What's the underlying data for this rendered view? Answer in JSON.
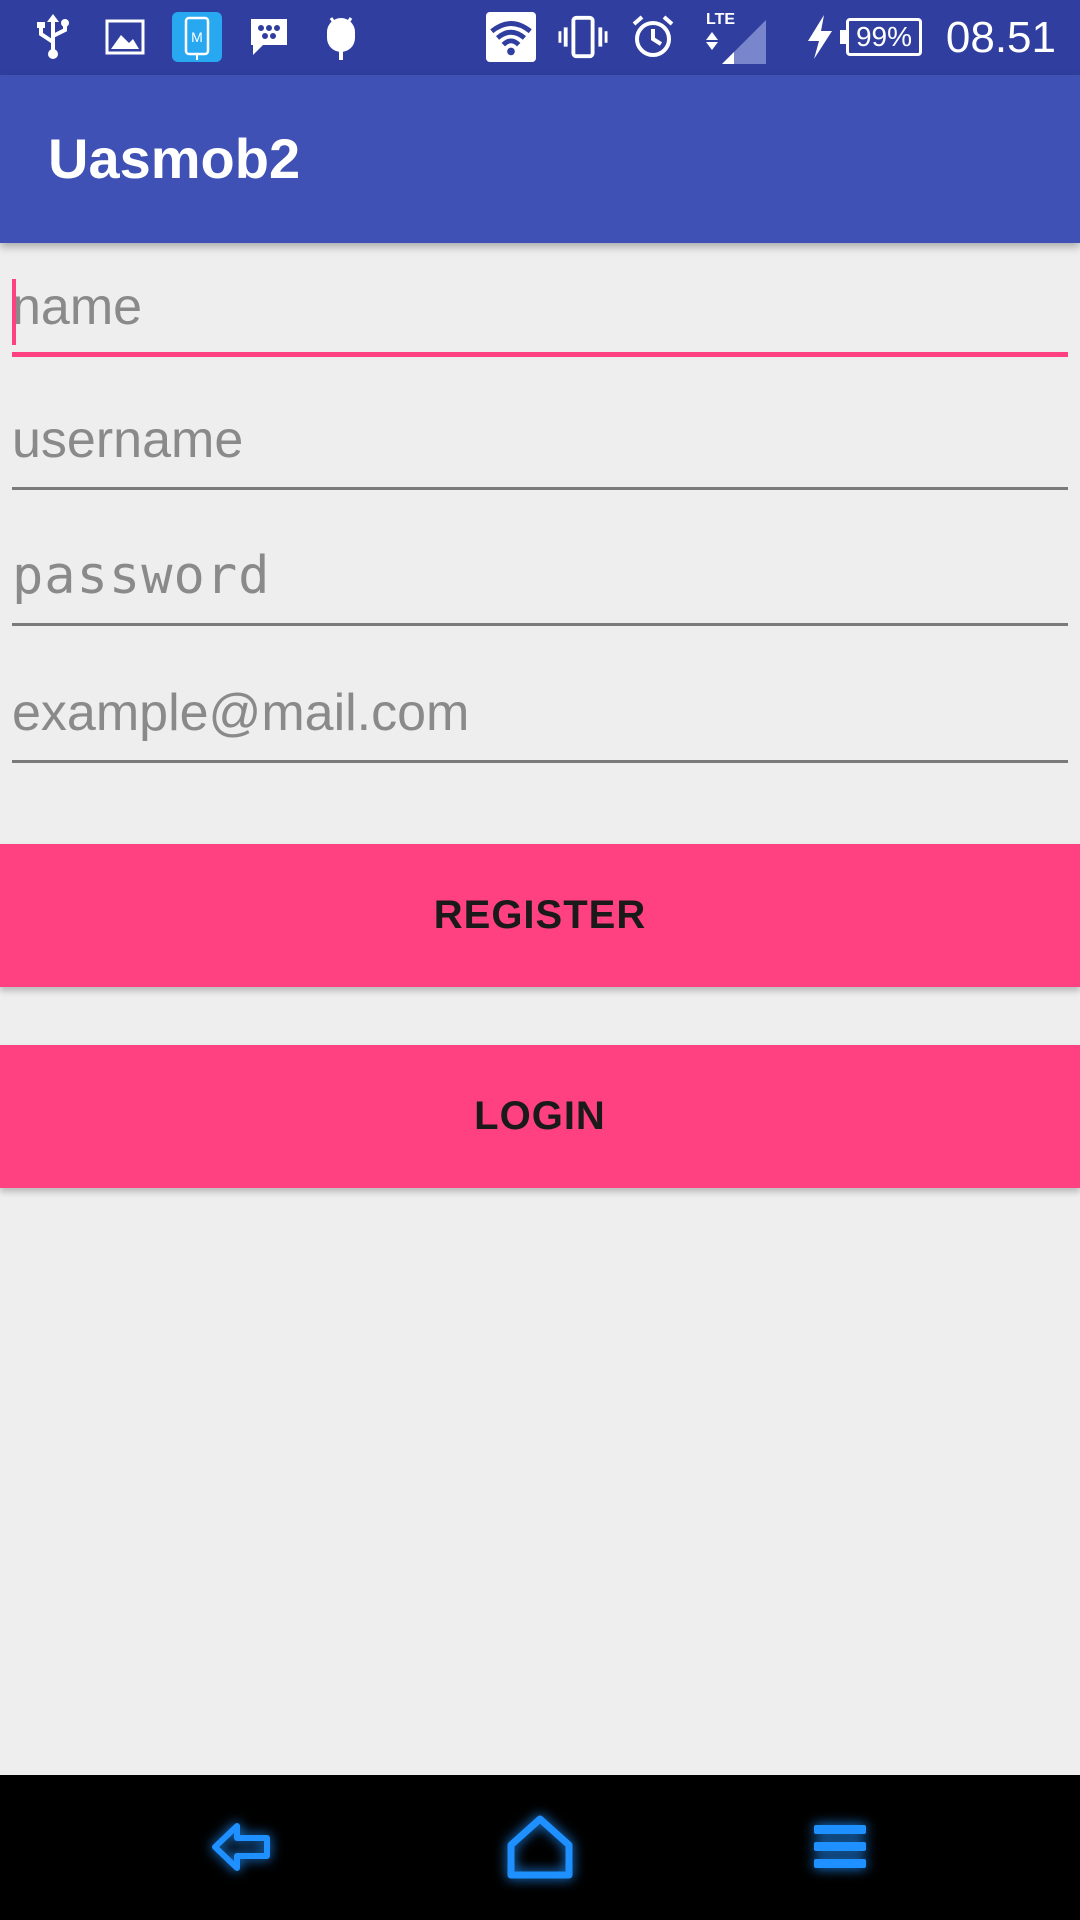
{
  "status_bar": {
    "battery": "99%",
    "time": "08.51",
    "network": "LTE",
    "icons": [
      "usb-icon",
      "image-icon",
      "screen-mirror-icon",
      "bbm-chat-icon",
      "android-debug-icon",
      "wifi-icon",
      "vibrate-icon",
      "alarm-icon",
      "signal-icon",
      "charging-icon",
      "battery-icon"
    ]
  },
  "app_bar": {
    "title": "Uasmob2"
  },
  "form": {
    "name_placeholder": "name",
    "username_placeholder": "username",
    "password_placeholder": "password",
    "email_placeholder": "example@mail.com",
    "register_label": "REGISTER",
    "login_label": "LOGIN"
  },
  "nav_bar": {
    "icons": [
      "back-icon",
      "home-icon",
      "menu-icon"
    ]
  },
  "colors": {
    "status_bar": "#303f9f",
    "app_bar": "#3f51b5",
    "accent": "#ff4081",
    "background": "#eeeeee",
    "nav_glow": "#1e90ff"
  }
}
